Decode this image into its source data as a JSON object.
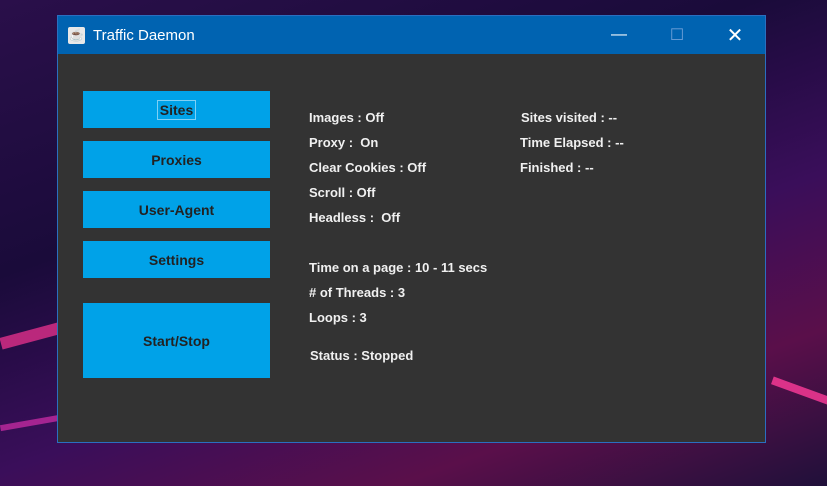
{
  "window": {
    "title": "Traffic Daemon",
    "minimize": "—",
    "maximize": "☐",
    "close": "✕"
  },
  "buttons": {
    "sites": "Sites",
    "proxies": "Proxies",
    "user_agent": "User-Agent",
    "settings": "Settings",
    "start_stop": "Start/Stop"
  },
  "settings": {
    "images": "Images : Off",
    "proxy": "Proxy :  On",
    "clear_cookies": "Clear Cookies : Off",
    "scroll": "Scroll : Off",
    "headless": "Headless :  Off",
    "time_on_page": "Time on a page : 10 - 11 secs",
    "threads": "# of Threads : 3",
    "loops": "Loops : 3",
    "status": "Status : Stopped"
  },
  "stats": {
    "sites_visited": "Sites visited : --",
    "time_elapsed": "Time Elapsed : --",
    "finished": "Finished : --"
  }
}
